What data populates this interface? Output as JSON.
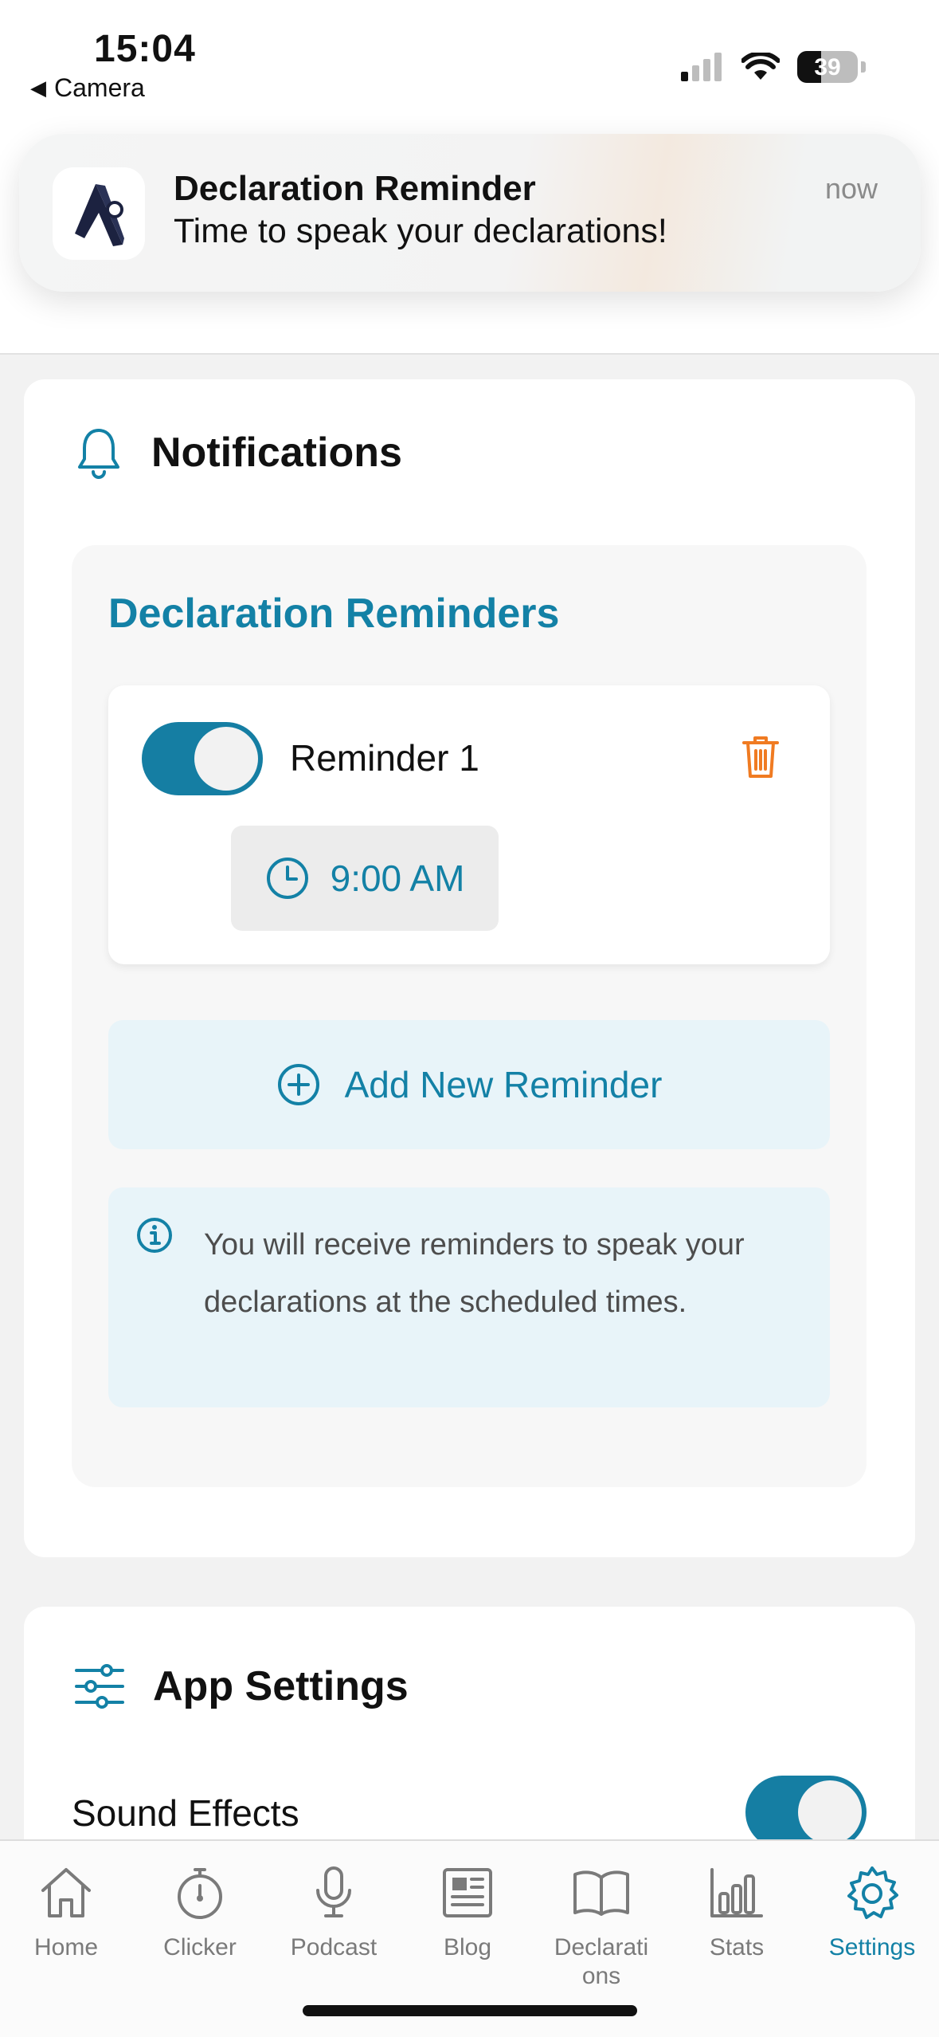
{
  "status_bar": {
    "time": "15:04",
    "back_label": "Camera",
    "battery": "39"
  },
  "banner": {
    "title": "Declaration Reminder",
    "body": "Time to speak your declarations!",
    "time": "now"
  },
  "notifications": {
    "title": "Notifications",
    "section_title": "Declaration Reminders",
    "reminders": [
      {
        "label": "Reminder 1",
        "time": "9:00 AM",
        "enabled": true
      }
    ],
    "add_label": "Add New Reminder",
    "info_text": "You will receive reminders to speak your declarations at the scheduled times."
  },
  "app_settings": {
    "title": "App Settings",
    "sound_effects_label": "Sound Effects",
    "sound_effects_enabled": true
  },
  "tabs": [
    {
      "label": "Home",
      "icon": "home-icon"
    },
    {
      "label": "Clicker",
      "icon": "stopwatch-icon"
    },
    {
      "label": "Podcast",
      "icon": "microphone-icon"
    },
    {
      "label": "Blog",
      "icon": "newspaper-icon"
    },
    {
      "label": "Declarati\nons",
      "icon": "book-icon"
    },
    {
      "label": "Stats",
      "icon": "bar-chart-icon"
    },
    {
      "label": "Settings",
      "icon": "gear-icon",
      "active": true
    }
  ],
  "colors": {
    "accent": "#1381a6",
    "toggle_on": "#157ea3",
    "delete": "#f07b22",
    "info_bg": "#e8f4f9"
  }
}
